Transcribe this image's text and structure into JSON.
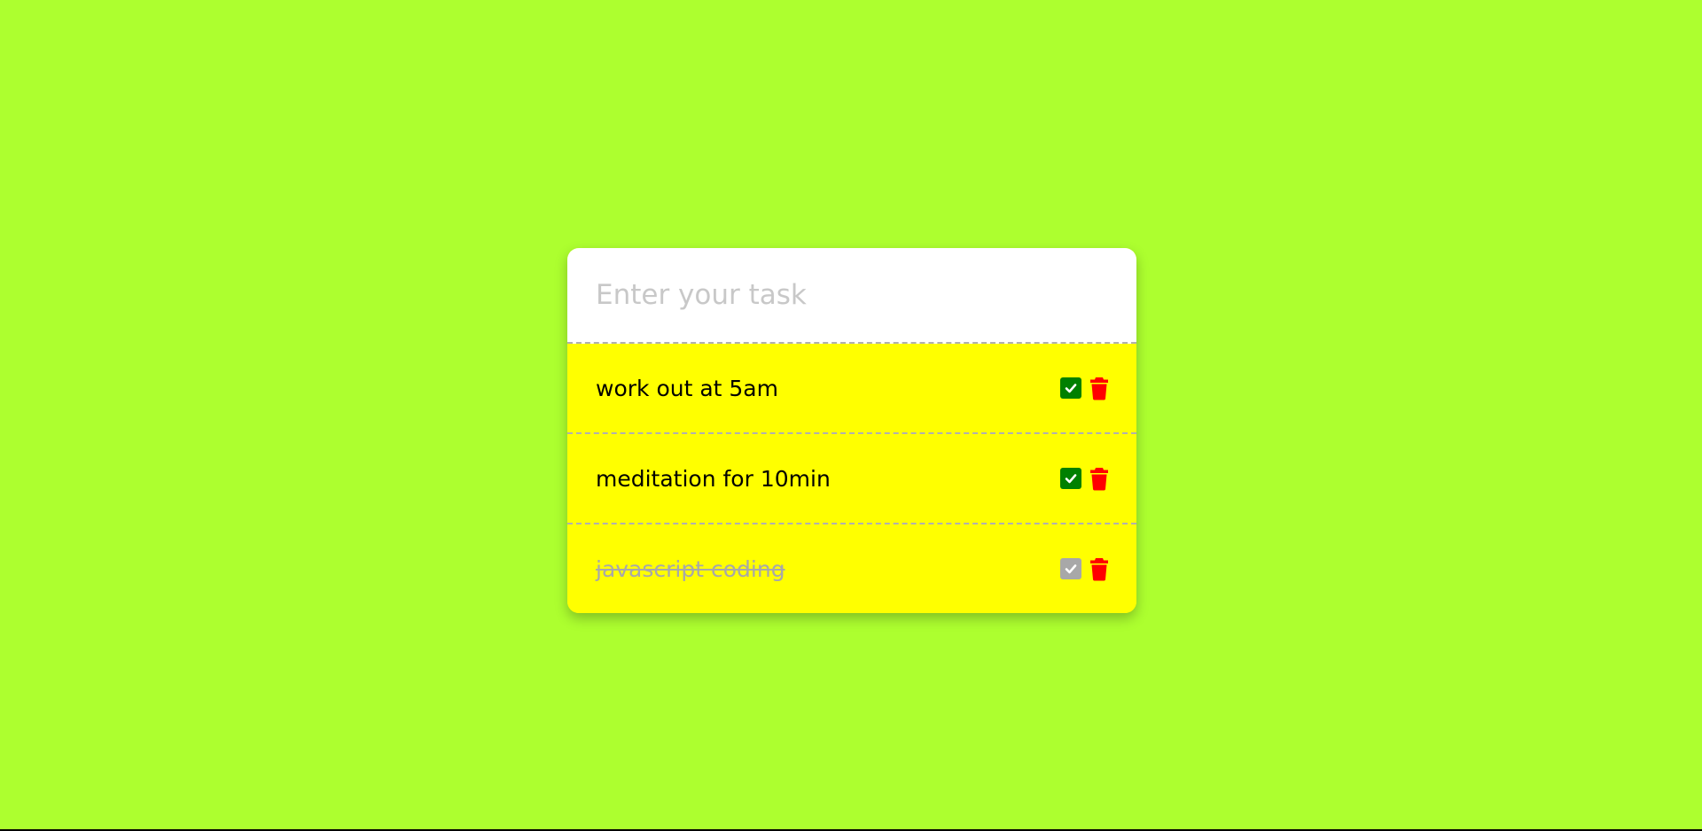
{
  "colors": {
    "background": "#adff2f",
    "list_background": "#ffff00",
    "check_active": "#008000",
    "check_done": "#a8a8a8",
    "trash": "#ff0000"
  },
  "input": {
    "value": "",
    "placeholder": "Enter your task"
  },
  "tasks": [
    {
      "text": "work out at 5am",
      "done": false,
      "check_icon": "check-square-icon",
      "delete_icon": "trash-icon"
    },
    {
      "text": "meditation for 10min",
      "done": false,
      "check_icon": "check-square-icon",
      "delete_icon": "trash-icon"
    },
    {
      "text": "javascript coding",
      "done": true,
      "check_icon": "check-square-icon",
      "delete_icon": "trash-icon"
    }
  ]
}
